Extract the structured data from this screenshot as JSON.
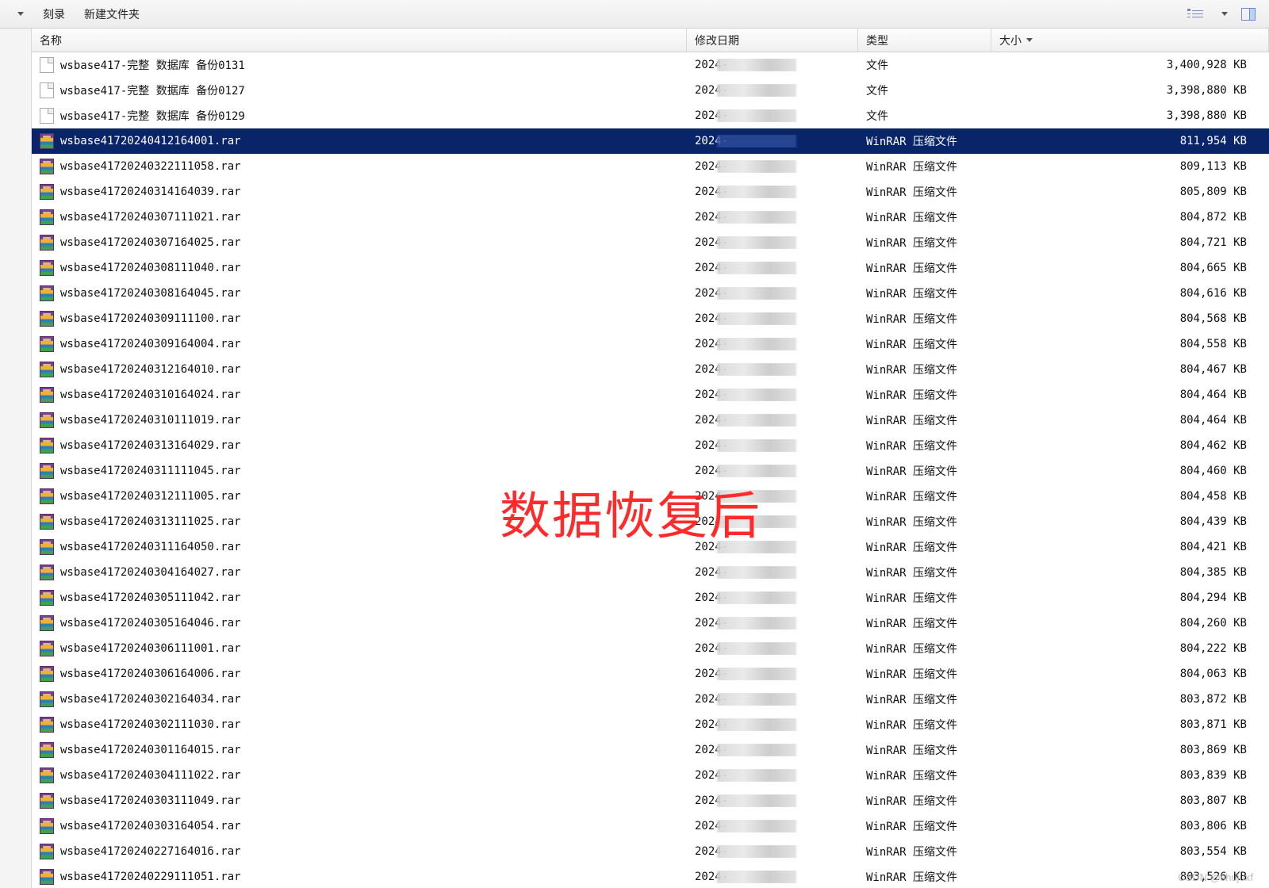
{
  "toolbar": {
    "burn_label": "刻录",
    "new_folder_label": "新建文件夹"
  },
  "columns": {
    "name": "名称",
    "date": "修改日期",
    "type": "类型",
    "size": "大小"
  },
  "type_labels": {
    "file": "文件",
    "rar": "WinRAR 压缩文件"
  },
  "rows": [
    {
      "icon": "doc",
      "name": "wsbase417-完整 数据库 备份0131",
      "date": "2024-",
      "type_key": "file",
      "size": "3,400,928 KB",
      "selected": false
    },
    {
      "icon": "doc",
      "name": "wsbase417-完整 数据库 备份0127",
      "date": "2024-",
      "type_key": "file",
      "size": "3,398,880 KB",
      "selected": false
    },
    {
      "icon": "doc",
      "name": "wsbase417-完整 数据库 备份0129",
      "date": "2024-",
      "type_key": "file",
      "size": "3,398,880 KB",
      "selected": false
    },
    {
      "icon": "rar",
      "name": "wsbase41720240412164001.rar",
      "date": "2024-",
      "type_key": "rar",
      "size": "811,954 KB",
      "selected": true
    },
    {
      "icon": "rar",
      "name": "wsbase41720240322111058.rar",
      "date": "2024-",
      "type_key": "rar",
      "size": "809,113 KB",
      "selected": false
    },
    {
      "icon": "rar",
      "name": "wsbase41720240314164039.rar",
      "date": "2024-",
      "type_key": "rar",
      "size": "805,809 KB",
      "selected": false
    },
    {
      "icon": "rar",
      "name": "wsbase41720240307111021.rar",
      "date": "2024-",
      "type_key": "rar",
      "size": "804,872 KB",
      "selected": false
    },
    {
      "icon": "rar",
      "name": "wsbase41720240307164025.rar",
      "date": "2024-",
      "type_key": "rar",
      "size": "804,721 KB",
      "selected": false
    },
    {
      "icon": "rar",
      "name": "wsbase41720240308111040.rar",
      "date": "2024-",
      "type_key": "rar",
      "size": "804,665 KB",
      "selected": false
    },
    {
      "icon": "rar",
      "name": "wsbase41720240308164045.rar",
      "date": "2024-",
      "type_key": "rar",
      "size": "804,616 KB",
      "selected": false
    },
    {
      "icon": "rar",
      "name": "wsbase41720240309111100.rar",
      "date": "2024-",
      "type_key": "rar",
      "size": "804,568 KB",
      "selected": false
    },
    {
      "icon": "rar",
      "name": "wsbase41720240309164004.rar",
      "date": "2024-",
      "type_key": "rar",
      "size": "804,558 KB",
      "selected": false
    },
    {
      "icon": "rar",
      "name": "wsbase41720240312164010.rar",
      "date": "2024-",
      "type_key": "rar",
      "size": "804,467 KB",
      "selected": false
    },
    {
      "icon": "rar",
      "name": "wsbase41720240310164024.rar",
      "date": "2024-",
      "type_key": "rar",
      "size": "804,464 KB",
      "selected": false
    },
    {
      "icon": "rar",
      "name": "wsbase41720240310111019.rar",
      "date": "2024-",
      "type_key": "rar",
      "size": "804,464 KB",
      "selected": false
    },
    {
      "icon": "rar",
      "name": "wsbase41720240313164029.rar",
      "date": "2024-",
      "type_key": "rar",
      "size": "804,462 KB",
      "selected": false
    },
    {
      "icon": "rar",
      "name": "wsbase41720240311111045.rar",
      "date": "2024-",
      "type_key": "rar",
      "size": "804,460 KB",
      "selected": false
    },
    {
      "icon": "rar",
      "name": "wsbase41720240312111005.rar",
      "date": "2024-",
      "type_key": "rar",
      "size": "804,458 KB",
      "selected": false
    },
    {
      "icon": "rar",
      "name": "wsbase41720240313111025.rar",
      "date": "2024-",
      "type_key": "rar",
      "size": "804,439 KB",
      "selected": false
    },
    {
      "icon": "rar",
      "name": "wsbase41720240311164050.rar",
      "date": "2024-",
      "type_key": "rar",
      "size": "804,421 KB",
      "selected": false
    },
    {
      "icon": "rar",
      "name": "wsbase41720240304164027.rar",
      "date": "2024-",
      "type_key": "rar",
      "size": "804,385 KB",
      "selected": false
    },
    {
      "icon": "rar",
      "name": "wsbase41720240305111042.rar",
      "date": "2024-",
      "type_key": "rar",
      "size": "804,294 KB",
      "selected": false
    },
    {
      "icon": "rar",
      "name": "wsbase41720240305164046.rar",
      "date": "2024-",
      "type_key": "rar",
      "size": "804,260 KB",
      "selected": false
    },
    {
      "icon": "rar",
      "name": "wsbase41720240306111001.rar",
      "date": "2024-",
      "type_key": "rar",
      "size": "804,222 KB",
      "selected": false
    },
    {
      "icon": "rar",
      "name": "wsbase41720240306164006.rar",
      "date": "2024-",
      "type_key": "rar",
      "size": "804,063 KB",
      "selected": false
    },
    {
      "icon": "rar",
      "name": "wsbase41720240302164034.rar",
      "date": "2024-",
      "type_key": "rar",
      "size": "803,872 KB",
      "selected": false
    },
    {
      "icon": "rar",
      "name": "wsbase41720240302111030.rar",
      "date": "2024-",
      "type_key": "rar",
      "size": "803,871 KB",
      "selected": false
    },
    {
      "icon": "rar",
      "name": "wsbase41720240301164015.rar",
      "date": "2024-",
      "type_key": "rar",
      "size": "803,869 KB",
      "selected": false
    },
    {
      "icon": "rar",
      "name": "wsbase41720240304111022.rar",
      "date": "2024-",
      "type_key": "rar",
      "size": "803,839 KB",
      "selected": false
    },
    {
      "icon": "rar",
      "name": "wsbase41720240303111049.rar",
      "date": "2024-",
      "type_key": "rar",
      "size": "803,807 KB",
      "selected": false
    },
    {
      "icon": "rar",
      "name": "wsbase41720240303164054.rar",
      "date": "2024-",
      "type_key": "rar",
      "size": "803,806 KB",
      "selected": false
    },
    {
      "icon": "rar",
      "name": "wsbase41720240227164016.rar",
      "date": "2024-",
      "type_key": "rar",
      "size": "803,554 KB",
      "selected": false
    },
    {
      "icon": "rar",
      "name": "wsbase41720240229111051.rar",
      "date": "2024-",
      "type_key": "rar",
      "size": "803,526 KB",
      "selected": false
    }
  ],
  "overlay_text": "数据恢复后",
  "watermark": "CSDN @shujuxf"
}
